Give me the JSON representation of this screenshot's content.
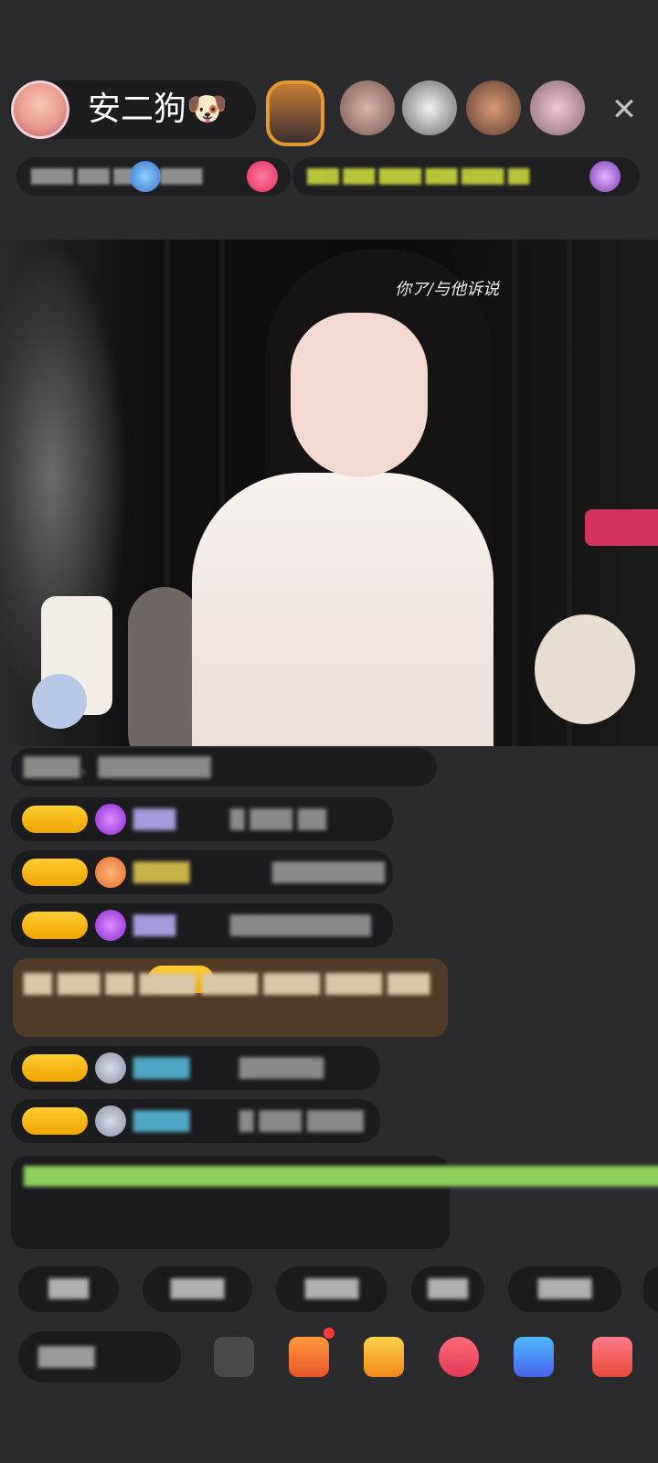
{
  "header": {
    "streamer_name": "安二狗🐶",
    "close_icon": "close-icon",
    "viewer_avatars": [
      "viewer-avatar",
      "viewer-avatar",
      "viewer-avatar",
      "viewer-avatar",
      "viewer-avatar"
    ]
  },
  "info": {
    "left_text": "████ ███ ████ ████",
    "right_text": "███ ███ ████ ███ ████ ██"
  },
  "video": {
    "caption": "你ア/与他诉说"
  },
  "chat": {
    "system_line": "████、████████",
    "messages": [
      {
        "level": "████",
        "user": "███",
        "text": "█ ███ ██"
      },
      {
        "level": "████",
        "user": "████",
        "text": "████████"
      },
      {
        "level": "████",
        "user": "███",
        "text": "██████████"
      },
      {
        "level": "████",
        "user": "████",
        "text": "██████"
      },
      {
        "level": "████",
        "user": "████",
        "text": "█ ███ ████"
      }
    ],
    "gold_message": "██ ███ ██ ████ ████ ████ ████ ███",
    "notice": "█████████████████████████████████████████████████"
  },
  "quick_replies": [
    "███",
    "████",
    "████",
    "███",
    "████"
  ],
  "bottom": {
    "input_placeholder": "████"
  }
}
